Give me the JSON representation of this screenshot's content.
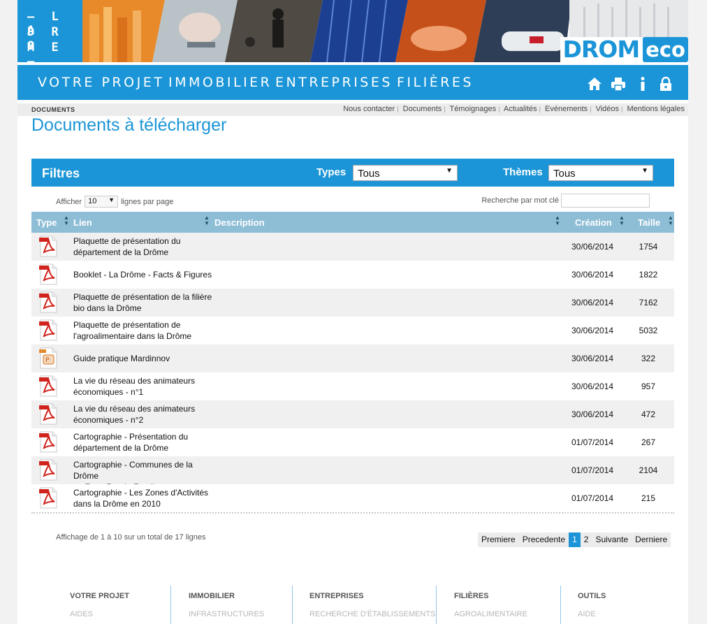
{
  "header": {
    "logo_lines": [
      "– L A",
      "D R O",
      "M E –"
    ],
    "brand_a": "DROM",
    "brand_b": "eco"
  },
  "nav": {
    "items": [
      "VOTRE PROJET",
      "IMMOBILIER",
      "ENTREPRISES",
      "FILIÈRES"
    ],
    "icons": [
      "home-icon",
      "print-icon",
      "info-icon",
      "lock-icon"
    ]
  },
  "breadcrumb": "DOCUMENTS",
  "toplinks": [
    "Nous contacter",
    "Documents",
    "Témoignages",
    "Actualités",
    "Evénements",
    "Vidéos",
    "Mentions légales"
  ],
  "page_title": "Documents à télécharger",
  "filters": {
    "title": "Filtres",
    "types_label": "Types",
    "types_value": "Tous",
    "themes_label": "Thèmes",
    "themes_value": "Tous"
  },
  "controls": {
    "show_prefix": "Afficher",
    "show_value": "10",
    "show_suffix": "lignes par page",
    "search_label": "Recherche par mot clé",
    "search_value": ""
  },
  "table": {
    "headers": {
      "type": "Type",
      "lien": "Lien",
      "description": "Description",
      "creation": "Création",
      "taille": "Taille"
    },
    "rows": [
      {
        "icon": "pdf",
        "lines": [
          "Plaquette de présentation du",
          "département de la Drôme"
        ],
        "date": "30/06/2014",
        "size": "1754"
      },
      {
        "icon": "pdf",
        "lines": [
          "Booklet - La Drôme - Facts & Figures"
        ],
        "date": "30/06/2014",
        "size": "1822"
      },
      {
        "icon": "pdf",
        "lines": [
          "Plaquette de présentation de la filière",
          "bio dans la Drôme"
        ],
        "date": "30/06/2014",
        "size": "7162"
      },
      {
        "icon": "pdf",
        "lines": [
          "Plaquette de présentation de",
          "l'agroalimentaire dans la Drôme"
        ],
        "date": "30/06/2014",
        "size": "5032"
      },
      {
        "icon": "ppt",
        "lines": [
          "Guide pratique Mardinnov"
        ],
        "date": "30/06/2014",
        "size": "322"
      },
      {
        "icon": "pdf",
        "lines": [
          "La vie du réseau des animateurs",
          "économiques - n°1"
        ],
        "date": "30/06/2014",
        "size": "957"
      },
      {
        "icon": "pdf",
        "lines": [
          "La vie du réseau des animateurs",
          "économiques - n°2"
        ],
        "date": "30/06/2014",
        "size": "472"
      },
      {
        "icon": "pdf",
        "lines": [
          "Cartographie - Présentation du",
          "département de la Drôme"
        ],
        "date": "01/07/2014",
        "size": "267"
      },
      {
        "icon": "pdf",
        "lines": [
          "Cartographie - Communes de la Drôme",
          "en Zone Rurale Fragile"
        ],
        "date": "01/07/2014",
        "size": "2104"
      },
      {
        "icon": "pdf",
        "lines": [
          "Cartographie - Les Zones d'Activités",
          "dans la Drôme en 2010"
        ],
        "date": "01/07/2014",
        "size": "215"
      }
    ]
  },
  "info": "Affichage de 1 à 10 sur un total de 17 lignes",
  "pager": {
    "first": "Premiere",
    "prev": "Precedente",
    "pages": [
      "1",
      "2"
    ],
    "active_page": "1",
    "next": "Suivante",
    "last": "Derniere"
  },
  "footer": [
    {
      "heading": "VOTRE PROJET",
      "sub": "AIDES"
    },
    {
      "heading": "IMMOBILIER",
      "sub": "INFRASTRUCTURES"
    },
    {
      "heading": "ENTREPRISES",
      "sub": "RECHERCHE D'ÉTABLISSEMENTS"
    },
    {
      "heading": "FILIÈRES",
      "sub": "AGROALIMENTAIRE"
    },
    {
      "heading": "OUTILS",
      "sub": "AIDE"
    }
  ],
  "colors": {
    "accent": "#1b95d7",
    "table_header": "#8ebdd6",
    "row_alt": "#f0f0f0"
  }
}
